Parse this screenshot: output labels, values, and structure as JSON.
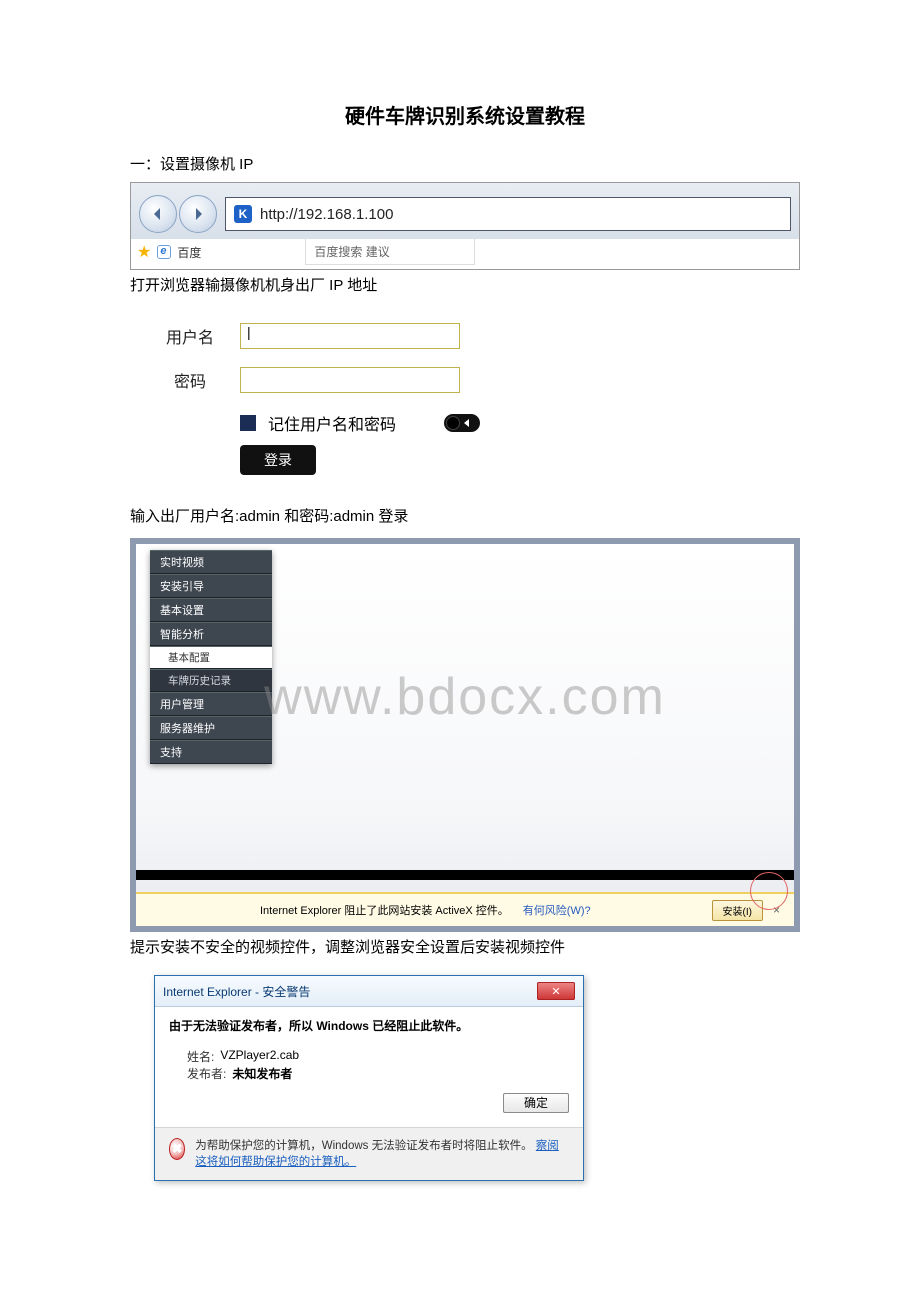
{
  "doc": {
    "title": "硬件车牌识别系统设置教程",
    "section1": "一：设置摄像机 IP",
    "caption_open": "打开浏览器输摄像机机身出厂 IP 地址",
    "caption_login": "输入出厂用户名:admin 和密码:admin  登录",
    "caption_activex": "提示安装不安全的视频控件，调整浏览器安全设置后安装视频控件"
  },
  "browser": {
    "url": "http://192.168.1.100",
    "fav_site": "百度",
    "suggestion": "百度搜索 建议"
  },
  "login": {
    "username_label": "用户名",
    "username_value": "|",
    "password_label": "密码",
    "remember_label": "记住用户名和密码",
    "login_btn": "登录"
  },
  "sidebar": {
    "items": [
      {
        "label": "实时视频",
        "sub": false,
        "active": false
      },
      {
        "label": "安装引导",
        "sub": false,
        "active": false
      },
      {
        "label": "基本设置",
        "sub": false,
        "active": false
      },
      {
        "label": "智能分析",
        "sub": false,
        "active": false
      },
      {
        "label": "基本配置",
        "sub": true,
        "active": true
      },
      {
        "label": "车牌历史记录",
        "sub": true,
        "active": false
      },
      {
        "label": "用户管理",
        "sub": false,
        "active": false
      },
      {
        "label": "服务器维护",
        "sub": false,
        "active": false
      },
      {
        "label": "支持",
        "sub": false,
        "active": false
      }
    ]
  },
  "activex_bar": {
    "msg": "Internet Explorer 阻止了此网站安装 ActiveX 控件。",
    "risk_link": "有何风险(W)?",
    "install_btn": "安装(I)",
    "close": "×"
  },
  "watermark": "www.bdocx.com",
  "dialog": {
    "title": "Internet Explorer  -  安全警告",
    "headline": "由于无法验证发布者，所以 Windows 已经阻止此软件。",
    "name_label": "姓名:",
    "name_value": "VZPlayer2.cab",
    "pub_label": "发布者:",
    "pub_value": "未知发布者",
    "ok_btn": "确定",
    "footer_text": "为帮助保护您的计算机，Windows 无法验证发布者时将阻止软件。",
    "footer_link": "察阅这将如何帮助保护您的计算机。"
  }
}
